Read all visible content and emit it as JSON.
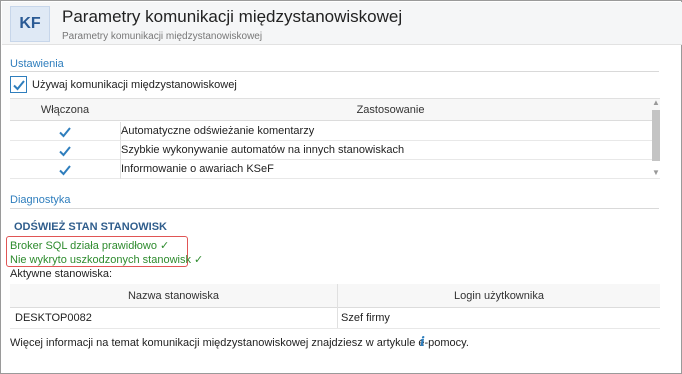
{
  "header": {
    "logo_text": "KF",
    "title": "Parametry komunikacji międzystanowiskowej",
    "subtitle": "Parametry komunikacji międzystanowiskowej"
  },
  "settings": {
    "section_label": "Ustawienia",
    "enable_checkbox": {
      "label": "Używaj komunikacji międzystanowiskowej",
      "checked": true
    },
    "grid": {
      "columns": [
        "Włączona",
        "Zastosowanie"
      ],
      "rows": [
        {
          "enabled": true,
          "usage": "Automatyczne odświeżanie komentarzy"
        },
        {
          "enabled": true,
          "usage": "Szybkie wykonywanie automatów na innych stanowiskach"
        },
        {
          "enabled": true,
          "usage": "Informowanie o awariach KSeF"
        }
      ]
    }
  },
  "diagnostics": {
    "section_label": "Diagnostyka",
    "refresh_link": "ODŚWIEŻ STAN STANOWISK",
    "status_lines": [
      "Broker SQL działa prawidłowo ✓",
      "Nie wykryto uszkodzonych stanowisk ✓"
    ],
    "active_label": "Aktywne stanowiska:",
    "stations_table": {
      "columns": [
        "Nazwa stanowiska",
        "Login użytkownika"
      ],
      "rows": [
        {
          "station": "DESKTOP0082",
          "login": "Szef firmy"
        }
      ]
    }
  },
  "footer": {
    "info_text": "Więcej informacji na temat komunikacji międzystanowiskowej znajdziesz w artykule e-pomocy.",
    "info_icon": "info-icon"
  },
  "colors": {
    "accent": "#2f7ebd",
    "ok_green": "#2e8b2e",
    "highlight_red": "#e05555"
  }
}
